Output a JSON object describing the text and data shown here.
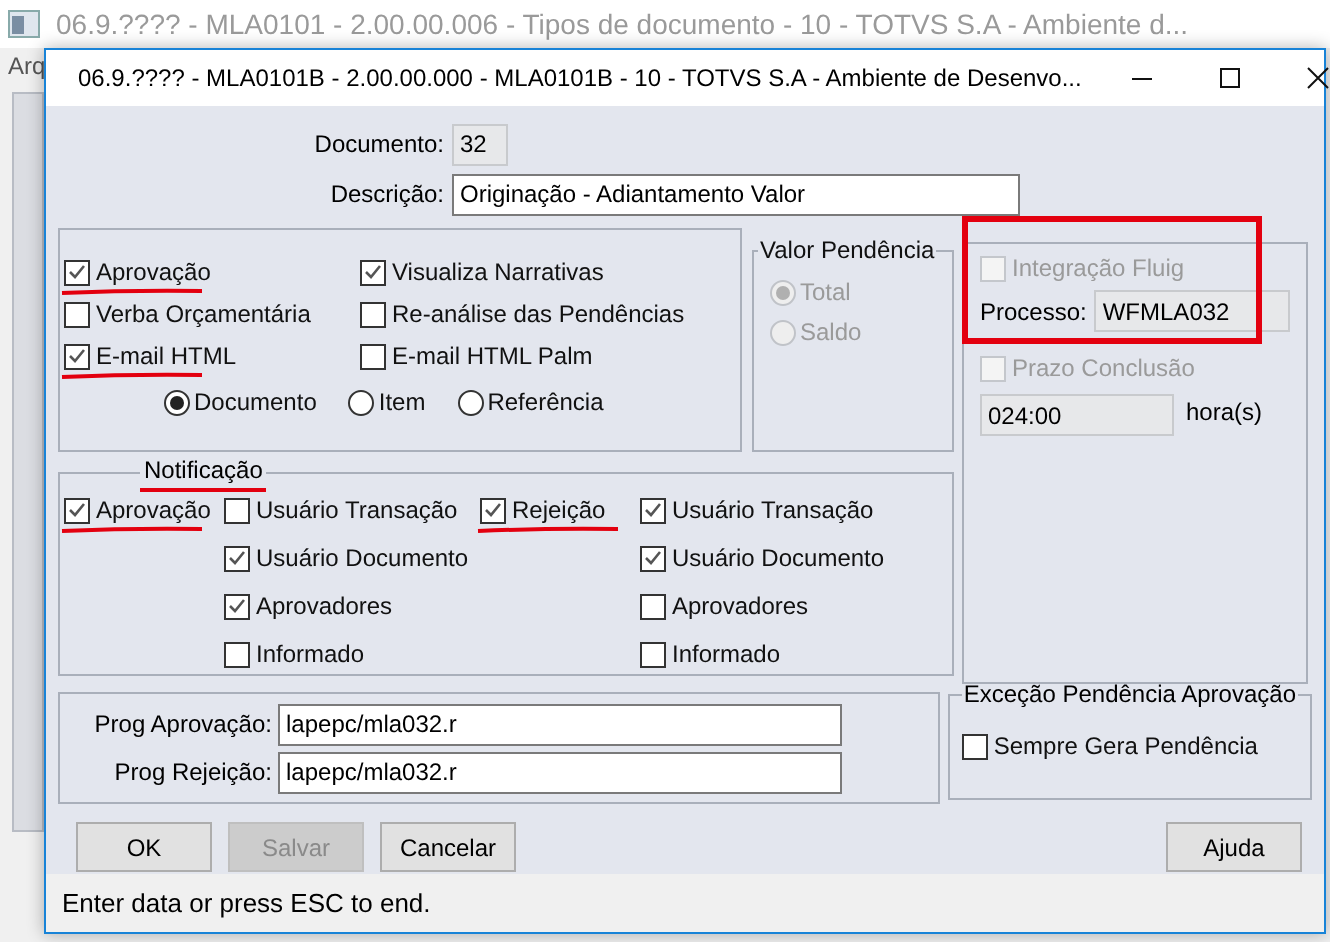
{
  "background_window": {
    "title": "06.9.???? - MLA0101 - 2.00.00.006 - Tipos de documento - 10 - TOTVS S.A - Ambiente d...",
    "menu": "Arq"
  },
  "dialog": {
    "title": "06.9.???? - MLA0101B - 2.00.00.000 - MLA0101B - 10 - TOTVS S.A - Ambiente de Desenvo..."
  },
  "documento": {
    "label": "Documento:",
    "value": "32"
  },
  "descricao": {
    "label": "Descrição:",
    "value": "Originação - Adiantamento Valor"
  },
  "options": [
    {
      "label": "Aprovação",
      "checked": true,
      "underlined": true
    },
    {
      "label": "Visualiza Narrativas",
      "checked": true,
      "underlined": false
    },
    {
      "label": "Verba Orçamentária",
      "checked": false,
      "underlined": false
    },
    {
      "label": "Re-análise das Pendências",
      "checked": false,
      "underlined": false
    },
    {
      "label": "E-mail HTML",
      "checked": true,
      "underlined": true
    },
    {
      "label": "E-mail HTML Palm",
      "checked": false,
      "underlined": false
    }
  ],
  "scope": [
    {
      "label": "Documento",
      "selected": true
    },
    {
      "label": "Item",
      "selected": false
    },
    {
      "label": "Referência",
      "selected": false
    }
  ],
  "valor_pendencia": {
    "title": "Valor Pendência",
    "disabled": true,
    "options": [
      {
        "label": "Total",
        "selected": true
      },
      {
        "label": "Saldo",
        "selected": false
      }
    ]
  },
  "fluig": {
    "label": "Integração Fluig",
    "checked": false,
    "disabled": true,
    "highlighted": true,
    "processo_label": "Processo:",
    "processo_value": "WFMLA032"
  },
  "prazo": {
    "label": "Prazo Conclusão",
    "checked": false,
    "disabled": true,
    "value": "024:00",
    "unit": "hora(s)"
  },
  "notificacao": {
    "title": "Notificação",
    "underlined": true,
    "columns": [
      {
        "main": {
          "label": "Aprovação",
          "checked": true,
          "underlined": true
        },
        "recipients": [
          {
            "label": "Usuário Transação",
            "checked": false
          },
          {
            "label": "Usuário Documento",
            "checked": true
          },
          {
            "label": "Aprovadores",
            "checked": true
          },
          {
            "label": "Informado",
            "checked": false
          }
        ]
      },
      {
        "main": {
          "label": "Rejeição",
          "checked": true,
          "underlined": true
        },
        "recipients": [
          {
            "label": "Usuário Transação",
            "checked": true
          },
          {
            "label": "Usuário Documento",
            "checked": true
          },
          {
            "label": "Aprovadores",
            "checked": false
          },
          {
            "label": "Informado",
            "checked": false
          }
        ]
      }
    ]
  },
  "programs": [
    {
      "label": "Prog Aprovação:",
      "value": "lapepc/mla032.r"
    },
    {
      "label": "Prog Rejeição:",
      "value": "lapepc/mla032.r"
    }
  ],
  "excecao": {
    "title": "Exceção Pendência Aprovação",
    "option": {
      "label": "Sempre Gera Pendência",
      "checked": false
    }
  },
  "buttons": [
    {
      "label": "OK",
      "disabled": false
    },
    {
      "label": "Salvar",
      "disabled": true
    },
    {
      "label": "Cancelar",
      "disabled": false
    },
    {
      "label": "Ajuda",
      "disabled": false
    }
  ],
  "status_bar": "Enter data or press ESC to end."
}
